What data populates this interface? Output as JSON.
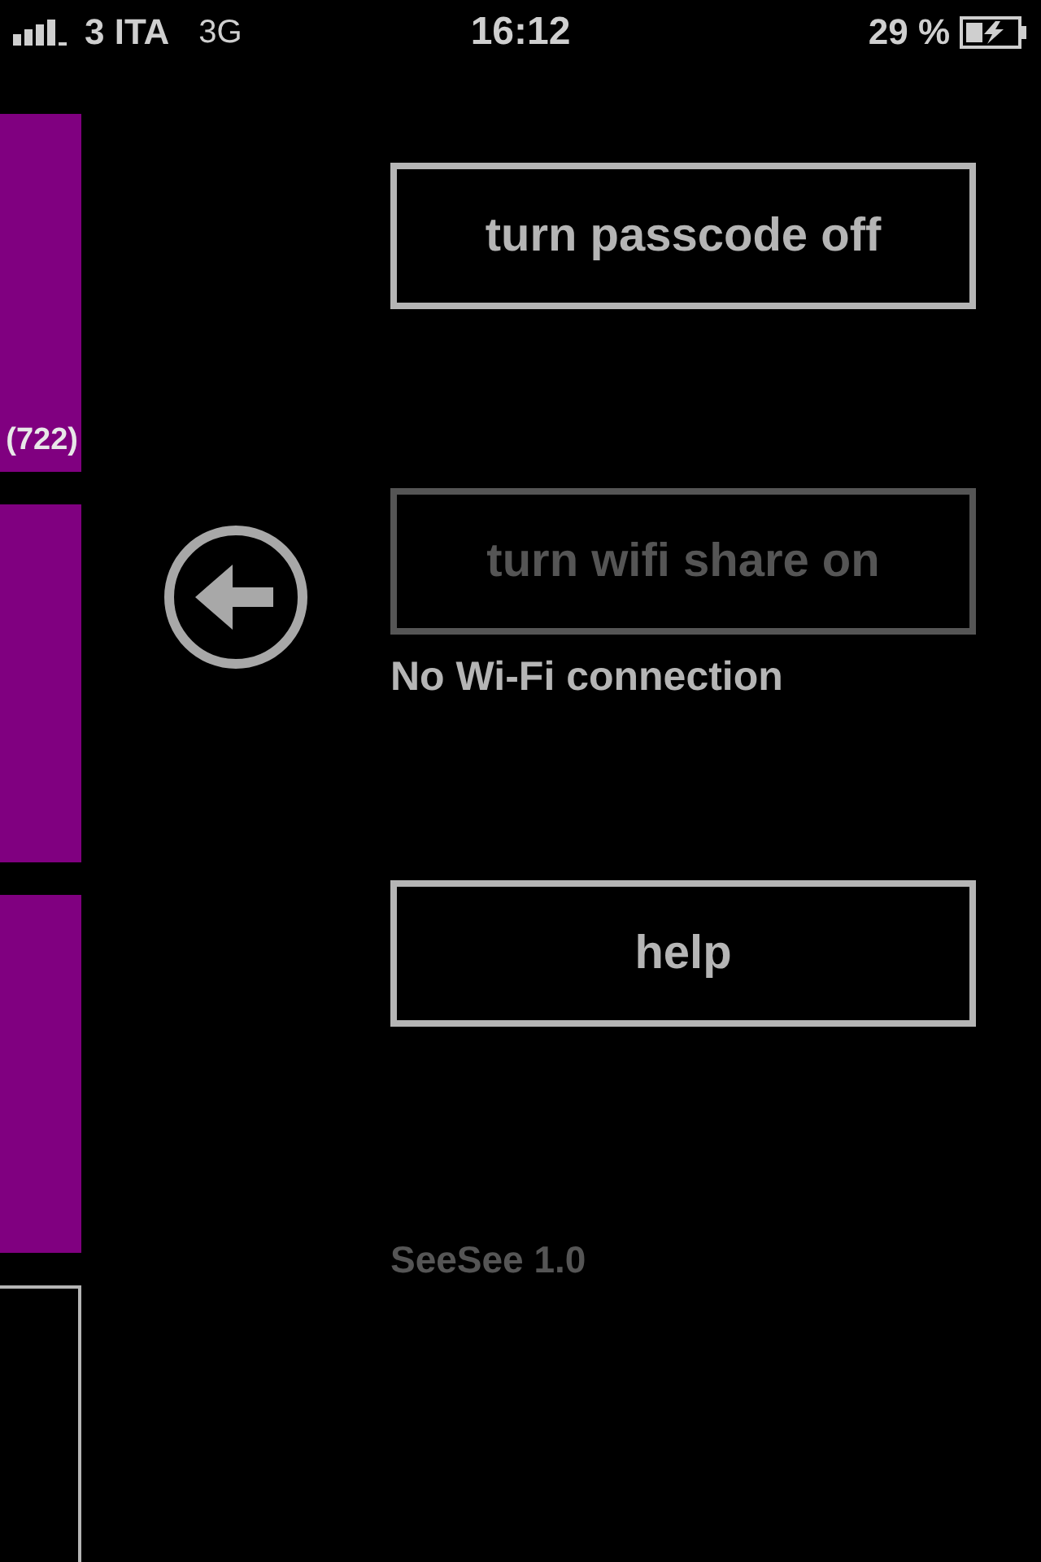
{
  "status_bar": {
    "carrier": "3 ITA",
    "network": "3G",
    "time": "16:12",
    "battery": "29 %"
  },
  "tiles": [
    {
      "kind": "filled",
      "label": "(722)"
    },
    {
      "kind": "filled"
    },
    {
      "kind": "filled"
    },
    {
      "kind": "outlined"
    }
  ],
  "actions": [
    {
      "label": "turn passcode off",
      "disabled": false
    },
    {
      "label": "turn wifi share on",
      "disabled": true,
      "note": "No Wi-Fi connection"
    },
    {
      "label": "help",
      "disabled": false
    }
  ],
  "version": "SeeSee 1.0"
}
